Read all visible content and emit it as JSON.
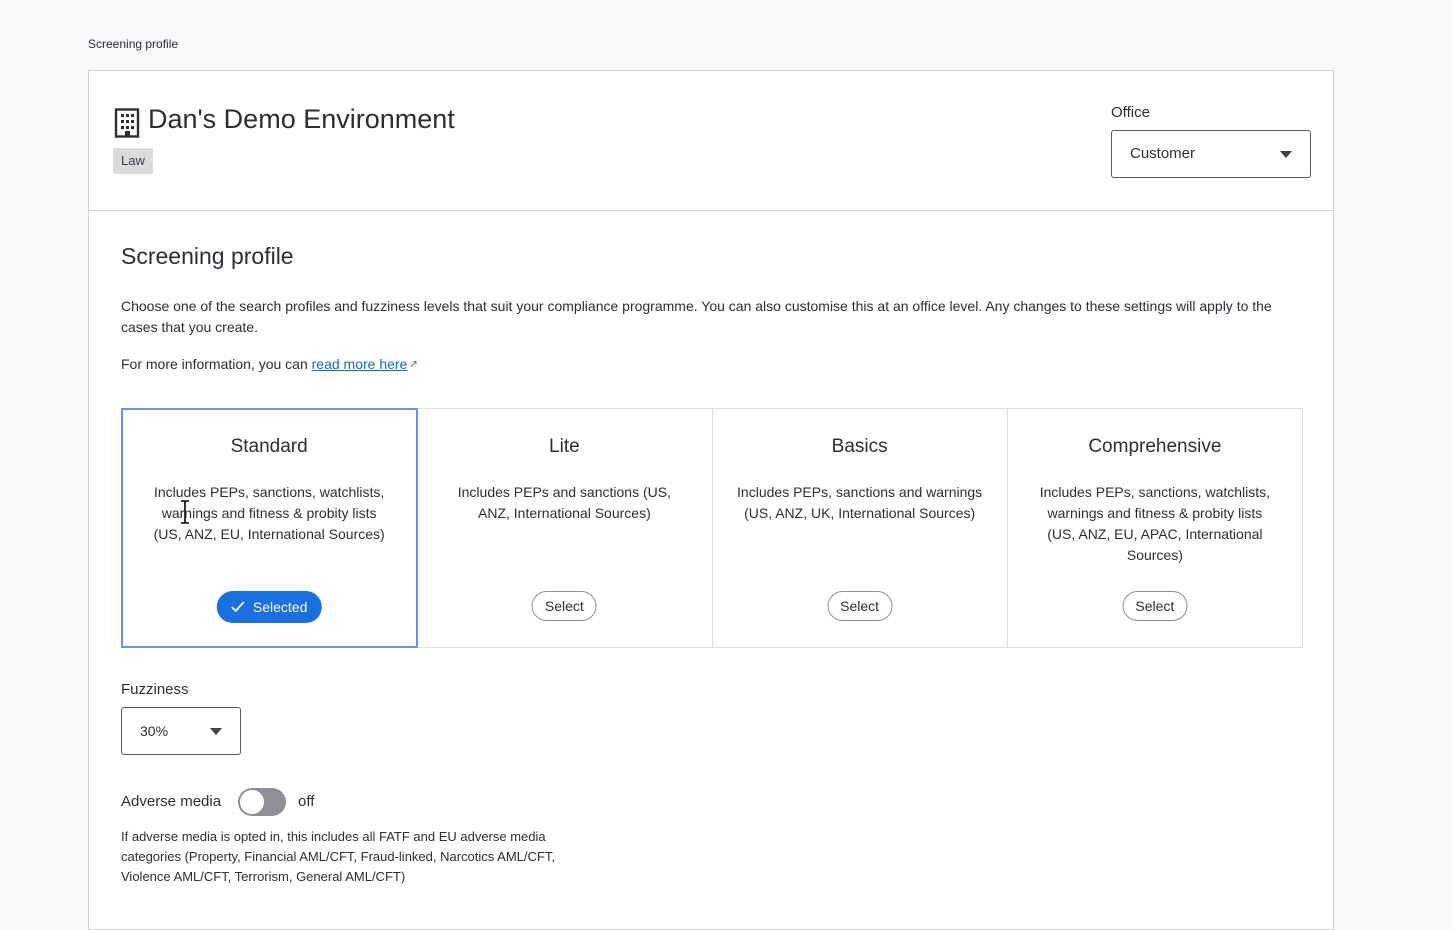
{
  "breadcrumb": "Screening profile",
  "org": {
    "name": "Dan's Demo Environment",
    "tag": "Law",
    "icon": "building-icon"
  },
  "office": {
    "label": "Office",
    "value": "Customer"
  },
  "section": {
    "title": "Screening profile",
    "description": "Choose one of the search profiles and fuzziness levels that suit your compliance programme. You can also customise this at an office level. Any changes to these settings will apply to the cases that you create.",
    "more_info_prefix": "For more information, you can",
    "more_info_link": "read more here"
  },
  "profiles": [
    {
      "title": "Standard",
      "description": "Includes PEPs, sanctions, watchlists, warnings and fitness & probity lists (US, ANZ, EU, International Sources)",
      "button": "Selected",
      "selected": true
    },
    {
      "title": "Lite",
      "description": "Includes PEPs and sanctions (US, ANZ, International Sources)",
      "button": "Select",
      "selected": false
    },
    {
      "title": "Basics",
      "description": "Includes PEPs, sanctions and warnings (US, ANZ, UK, International Sources)",
      "button": "Select",
      "selected": false
    },
    {
      "title": "Comprehensive",
      "description": "Includes PEPs, sanctions, watchlists, warnings and fitness & probity lists (US, ANZ, EU, APAC, International Sources)",
      "button": "Select",
      "selected": false
    }
  ],
  "fuzziness": {
    "label": "Fuzziness",
    "value": "30%"
  },
  "adverse_media": {
    "label": "Adverse media",
    "state": "off",
    "enabled": false,
    "description": "If adverse media is opted in, this includes all FATF and EU adverse media categories (Property, Financial AML/CFT, Fraud-linked, Narcotics AML/CFT, Violence AML/CFT, Terrorism, General AML/CFT)"
  },
  "colors": {
    "accent": "#1b70e0",
    "selected_border": "#6f8ff0",
    "link": "#1666c9",
    "toggle_off": "#8d9195"
  }
}
